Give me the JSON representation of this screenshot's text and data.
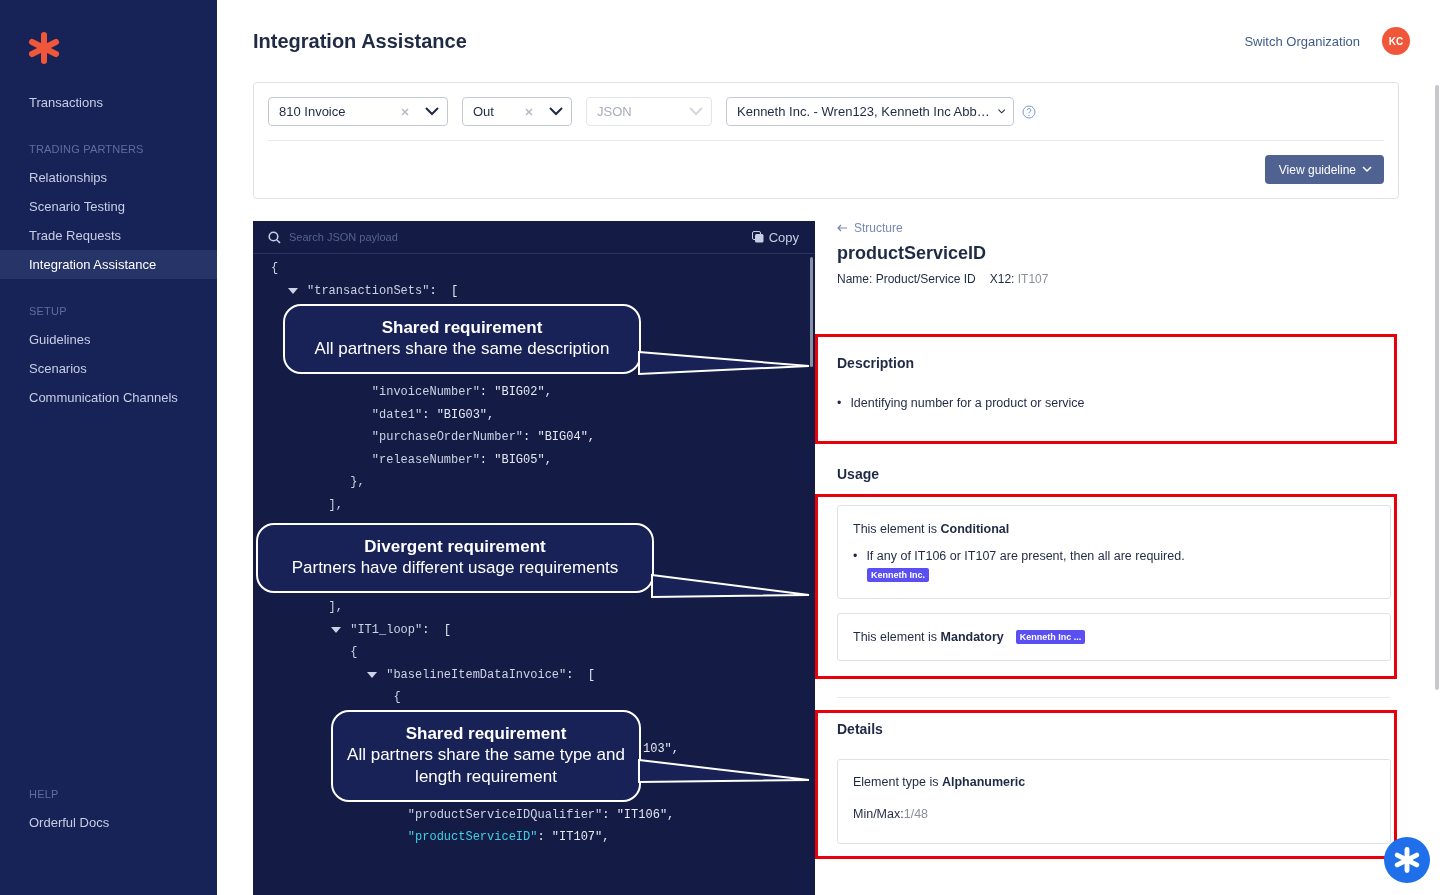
{
  "sidebar": {
    "sections": [
      {
        "items": [
          {
            "label": "Transactions",
            "selected": false
          }
        ]
      },
      {
        "heading": "TRADING PARTNERS",
        "items": [
          {
            "label": "Relationships",
            "selected": false
          },
          {
            "label": "Scenario Testing",
            "selected": false
          },
          {
            "label": "Trade Requests",
            "selected": false
          },
          {
            "label": "Integration Assistance",
            "selected": true
          }
        ]
      },
      {
        "heading": "SETUP",
        "items": [
          {
            "label": "Guidelines",
            "selected": false
          },
          {
            "label": "Scenarios",
            "selected": false
          },
          {
            "label": "Communication Channels",
            "selected": false
          }
        ]
      }
    ],
    "help": {
      "heading": "HELP",
      "items": [
        {
          "label": "Orderful Docs",
          "selected": false
        }
      ]
    }
  },
  "header": {
    "title": "Integration Assistance",
    "switch_link": "Switch Organization",
    "avatar": "KC"
  },
  "filters": {
    "selects": [
      {
        "value": "810 Invoice",
        "clearable": true,
        "disabled": false
      },
      {
        "value": "Out",
        "clearable": true,
        "disabled": false
      },
      {
        "value": "JSON",
        "clearable": false,
        "disabled": true
      },
      {
        "value": "Kenneth Inc. - Wren123, Kenneth Inc Abb…",
        "clearable": false,
        "disabled": false
      }
    ],
    "guideline_button": "View guideline"
  },
  "code_panel": {
    "search_placeholder": "Search JSON payload",
    "copy": "Copy",
    "blocks": [
      {
        "kind": "code",
        "lines": [
          {
            "key": "{",
            "selected": false
          },
          {
            "expanded": true,
            "key": "     \"transactionSets\"",
            "value": ":  [",
            "selected": false
          }
        ]
      },
      {
        "kind": "callout",
        "title": "Shared requirement",
        "text": "All partners share the same description"
      },
      {
        "kind": "code",
        "lines": [
          {
            "key": "              \"invoiceNumber\"",
            "value": ": \"BIG02\",",
            "selected": false
          },
          {
            "key": "              \"date1\"",
            "value": ": \"BIG03\",",
            "selected": false
          },
          {
            "key": "              \"purchaseOrderNumber\"",
            "value": ": \"BIG04\",",
            "selected": false
          },
          {
            "key": "              \"releaseNumber\"",
            "value": ": \"BIG05\",",
            "selected": false
          },
          {
            "key": "           },",
            "selected": false
          },
          {
            "key": "        ],",
            "selected": false
          }
        ]
      },
      {
        "kind": "callout",
        "title": "Divergent requirement",
        "text": "Partners have different usage requirements"
      },
      {
        "kind": "code",
        "lines": [
          {
            "key": "        ],",
            "selected": false
          },
          {
            "expanded": true,
            "key": "           \"IT1_loop\"",
            "value": ":  [",
            "selected": false
          },
          {
            "key": "           {",
            "selected": false
          },
          {
            "expanded": true,
            "key": "                \"baselineItemDataInvoice\"",
            "value": ":  [",
            "selected": false
          },
          {
            "key": "                 {",
            "selected": false
          }
        ]
      },
      {
        "kind": "callout",
        "title": "Shared requirement",
        "text": "All partners share the same type and length requirement",
        "aside": "103\","
      },
      {
        "kind": "code",
        "lines": [
          {
            "key": "                   \"productServiceIDQualifier\"",
            "value": ": \"IT106\",",
            "selected": false
          },
          {
            "key": "                   \"productServiceID\"",
            "value": ": \"IT107\",",
            "selected": true
          }
        ]
      }
    ]
  },
  "element": {
    "back_link": "Structure",
    "name": "productServiceID",
    "full_name": "Name: Product/Service ID",
    "x12_label": "X12:",
    "x12_value": "IT107",
    "description": {
      "heading": "Description",
      "bullets": [
        {
          "marker": "•",
          "text": "Identifying number for a product or service"
        }
      ]
    },
    "usage": {
      "heading": "Usage",
      "cards": [
        {
          "kind": "rule",
          "statement": "This element is **Conditional**",
          "bullets": [
            {
              "marker": "•",
              "text": "If any of IT106 or IT107 are present, then all are required."
            }
          ],
          "tag": "Kenneth Inc."
        },
        {
          "kind": "inline",
          "statement": "This element is **Mandatory**",
          "tag": "Kenneth Inc ..."
        }
      ]
    },
    "details": {
      "heading": "Details",
      "type_line": "Element type is **Alphanumeric**",
      "minmax_label": "Min/Max:",
      "minmax_value": "1/48"
    }
  }
}
